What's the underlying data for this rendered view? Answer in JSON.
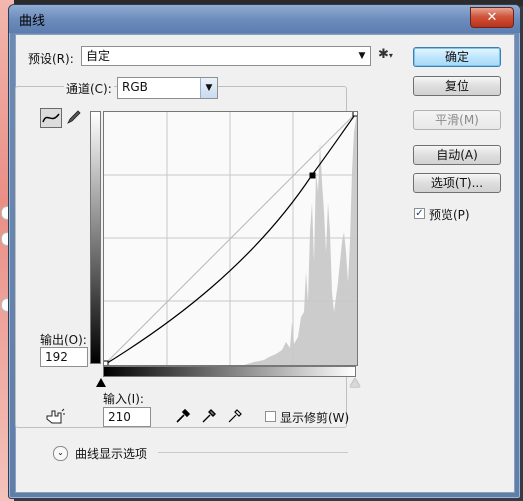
{
  "window": {
    "title": "曲线",
    "close_label": "✕"
  },
  "preset": {
    "label": "预设(R):",
    "value": "自定"
  },
  "channel": {
    "label": "通道(C):",
    "value": "RGB"
  },
  "buttons": {
    "ok": "确定",
    "reset": "复位",
    "smooth": "平滑(M)",
    "auto": "自动(A)",
    "options": "选项(T)..."
  },
  "preview": {
    "label": "预览(P)",
    "checked": true
  },
  "output": {
    "label": "输出(O):",
    "value": "192"
  },
  "input": {
    "label": "输入(I):",
    "value": "210"
  },
  "show_clipping": {
    "label": "显示修剪(W)",
    "checked": false
  },
  "curve_display_options": {
    "label": "曲线显示选项"
  },
  "icons": {
    "gear": "gear-icon",
    "curve_tool": "curve-tool-icon",
    "pencil_tool": "pencil-icon",
    "hand": "hand-adjust-icon",
    "eyedroppers": [
      "black-eyedropper-icon",
      "gray-eyedropper-icon",
      "white-eyedropper-icon"
    ]
  },
  "colors": {
    "accent": "#3c7fb1",
    "title_bar": "#6d8dbd",
    "close": "#c9452b"
  }
}
